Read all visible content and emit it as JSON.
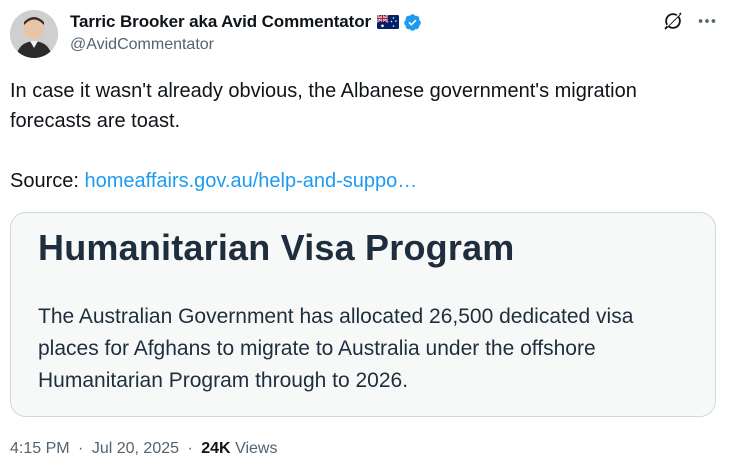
{
  "author": {
    "display_name": "Tarric Brooker aka Avid Commentator",
    "handle": "@AvidCommentator",
    "flag_icon": "australia-flag-icon",
    "verified_icon": "verified-badge-icon",
    "verified_color": "#1d9bf0"
  },
  "actions": {
    "grok_icon": "grok-icon",
    "more_icon": "more-options-icon"
  },
  "tweet": {
    "text_line": "In case it wasn't already obvious, the Albanese government's migration forecasts are toast.",
    "source_label": "Source: ",
    "source_link": "homeaffairs.gov.au/help-and-suppo…"
  },
  "card": {
    "title": "Humanitarian Visa Program",
    "body": "The Australian Government has allocated 26,500 dedicated visa places for Afghans to migrate to Australia under the offshore Humanitarian Program through to 2026."
  },
  "meta": {
    "time": "4:15 PM",
    "separator": "·",
    "date": "Jul 20, 2025",
    "views_count": "24K",
    "views_label": "Views"
  },
  "colors": {
    "link": "#1d9bf0",
    "secondary_text": "#536471",
    "primary_text": "#0f1419",
    "card_border": "#cfd9de",
    "card_background": "#f7f9f9",
    "card_text": "#1f2e3d"
  }
}
